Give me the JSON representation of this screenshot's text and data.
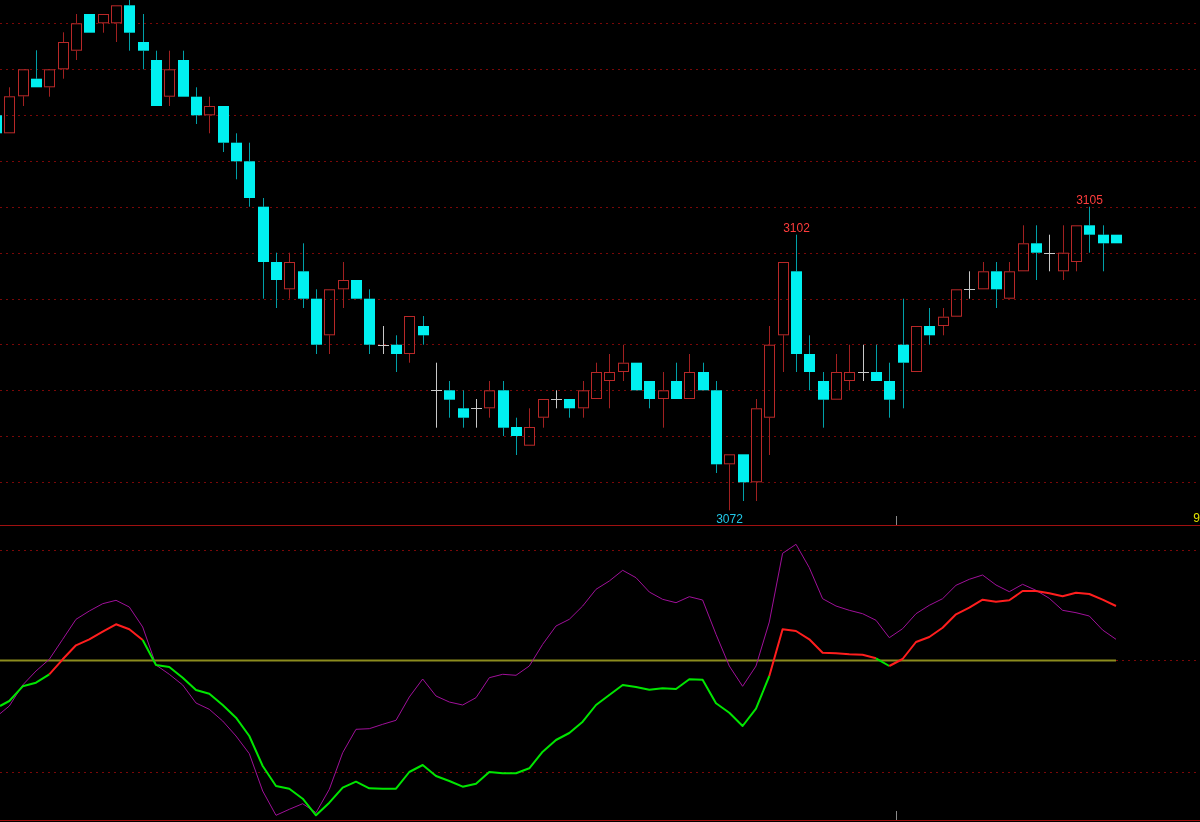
{
  "price_chart": {
    "annotations": [
      {
        "kind": "high",
        "text": "3102"
      },
      {
        "kind": "high",
        "text": "3105"
      },
      {
        "kind": "low",
        "text": "3072"
      }
    ],
    "right_axis_label": "9"
  }
}
